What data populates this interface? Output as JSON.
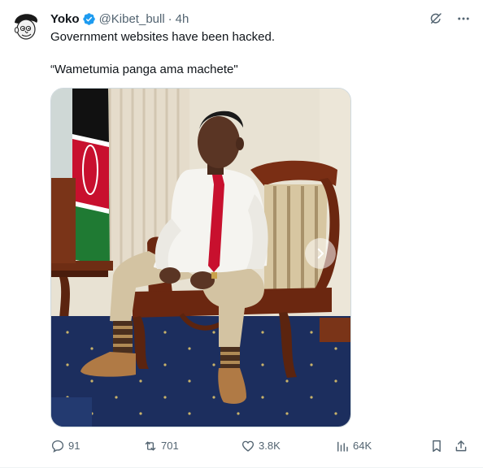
{
  "author": {
    "name": "Yoko",
    "handle": "@Kibet_bull",
    "separator": "·",
    "time": "4h",
    "verified_color": "#1d9bf0"
  },
  "header_icons": [
    "grok-icon",
    "more-icon"
  ],
  "tweet": {
    "line1": "Government websites have been hacked.",
    "line2": "“Wametumia panga ama machete\""
  },
  "media": {
    "description_icon": "photo",
    "next_icon": "chevron-right-icon"
  },
  "actions": {
    "replies": "91",
    "reposts": "701",
    "likes": "3.8K",
    "views": "64K"
  },
  "colors": {
    "text": "#0f1419",
    "secondary": "#536471",
    "accent": "#1d9bf0"
  }
}
